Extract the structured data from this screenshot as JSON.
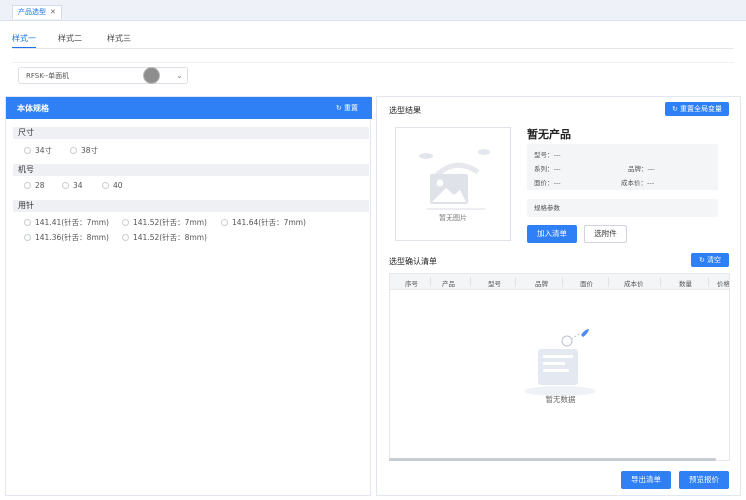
{
  "page_tab": {
    "label": "产品选型",
    "close": "✕"
  },
  "style_tabs": [
    {
      "label": "样式一",
      "active": true
    },
    {
      "label": "样式二",
      "active": false
    },
    {
      "label": "样式三",
      "active": false
    }
  ],
  "model_select": {
    "value": "RFSK--单面机"
  },
  "left_panel": {
    "title": "本体规格",
    "reset_label": "重置",
    "sections": {
      "size": {
        "label": "尺寸",
        "options": [
          "34寸",
          "38寸"
        ]
      },
      "machine": {
        "label": "机号",
        "options": [
          "28",
          "34",
          "40"
        ]
      },
      "needle": {
        "label": "用针",
        "options": [
          "141.41(针舌：7mm)",
          "141.52(针舌：7mm)",
          "141.64(针舌：7mm)",
          "141.36(针舌：8mm)",
          "141.52(针舌：8mm)"
        ]
      }
    }
  },
  "right_panel": {
    "title": "选型结果",
    "reset_all_label": "重置全局变量",
    "no_image": "暂无图片",
    "product_name": "暂无产品",
    "info": {
      "model": "型号：---",
      "series": "系列：---",
      "brand": "品牌：---",
      "face_price": "面价：---",
      "cost_price": "成本价：---"
    },
    "spec_params": "规格参数",
    "add_list_label": "加入清单",
    "select_accessory_label": "选附件",
    "confirm_title": "选型确认清单",
    "clear_label": "清空",
    "table_headers": [
      "序号",
      "产品",
      "型号",
      "品牌",
      "面价",
      "成本价",
      "数量",
      "价格"
    ],
    "empty_text": "暂无数据",
    "export_label": "导出清单",
    "preview_label": "预览报价"
  },
  "colors": {
    "accent": "#2f7ff5",
    "panel_border": "#e2e6ee",
    "section_bg": "#eef0f4"
  }
}
